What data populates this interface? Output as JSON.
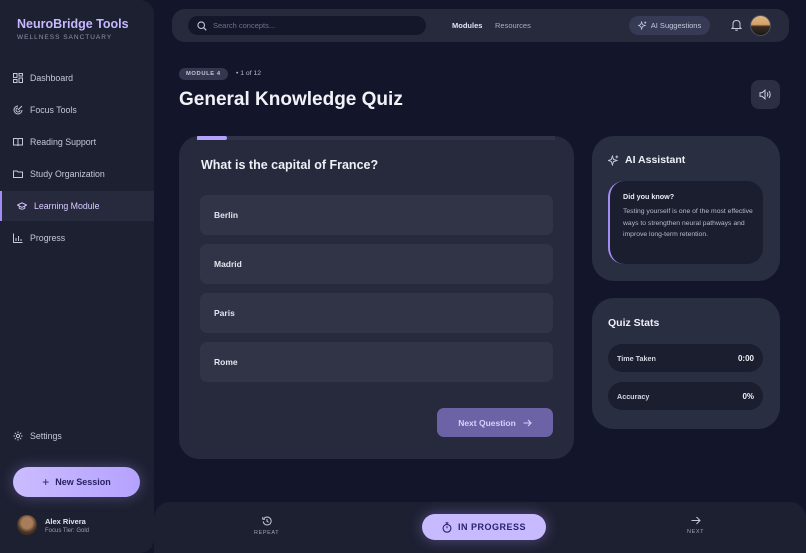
{
  "sidebar": {
    "brand": "NeuroBridge Tools",
    "brand_subtitle": "WELLNESS SANCTUARY",
    "items": [
      {
        "label": "Dashboard",
        "icon": "dashboard-icon"
      },
      {
        "label": "Focus Tools",
        "icon": "focus-icon"
      },
      {
        "label": "Reading Support",
        "icon": "book-icon"
      },
      {
        "label": "Study Organization",
        "icon": "folder-icon"
      },
      {
        "label": "Learning Module",
        "icon": "graduation-cap-icon",
        "active": true
      },
      {
        "label": "Progress",
        "icon": "bar-chart-icon"
      }
    ],
    "settings_label": "Settings",
    "new_session_label": "New Session",
    "user": {
      "name": "Alex Rivera",
      "tier": "Focus Tier: Gold"
    }
  },
  "topbar": {
    "search_placeholder": "Search concepts...",
    "links": [
      "Modules",
      "Resources"
    ],
    "ai_suggestions_label": "AI Suggestions"
  },
  "header": {
    "module_badge": "MODULE 4",
    "progress_text": "• 1 of 12",
    "title": "General Knowledge Quiz"
  },
  "quiz": {
    "progress_fraction": 0.083,
    "question": "What is the capital of France?",
    "options": [
      "Berlin",
      "Madrid",
      "Paris",
      "Rome"
    ],
    "next_label": "Next Question"
  },
  "assistant": {
    "title": "AI Assistant",
    "tip_title": "Did you know?",
    "tip_body": "Testing yourself is one of the most effective ways to strengthen neural pathways and improve long-term retention."
  },
  "stats": {
    "title": "Quiz Stats",
    "rows": [
      {
        "label": "Time Taken",
        "value": "0:00"
      },
      {
        "label": "Accuracy",
        "value": "0%"
      }
    ]
  },
  "bottombar": {
    "repeat_label": "REPEAT",
    "status_label": "IN PROGRESS",
    "next_label": "NEXT"
  },
  "colors": {
    "accent": "#b3a1ff",
    "background": "#13162a",
    "card": "#262a3c",
    "sidebar": "#1d2031"
  }
}
